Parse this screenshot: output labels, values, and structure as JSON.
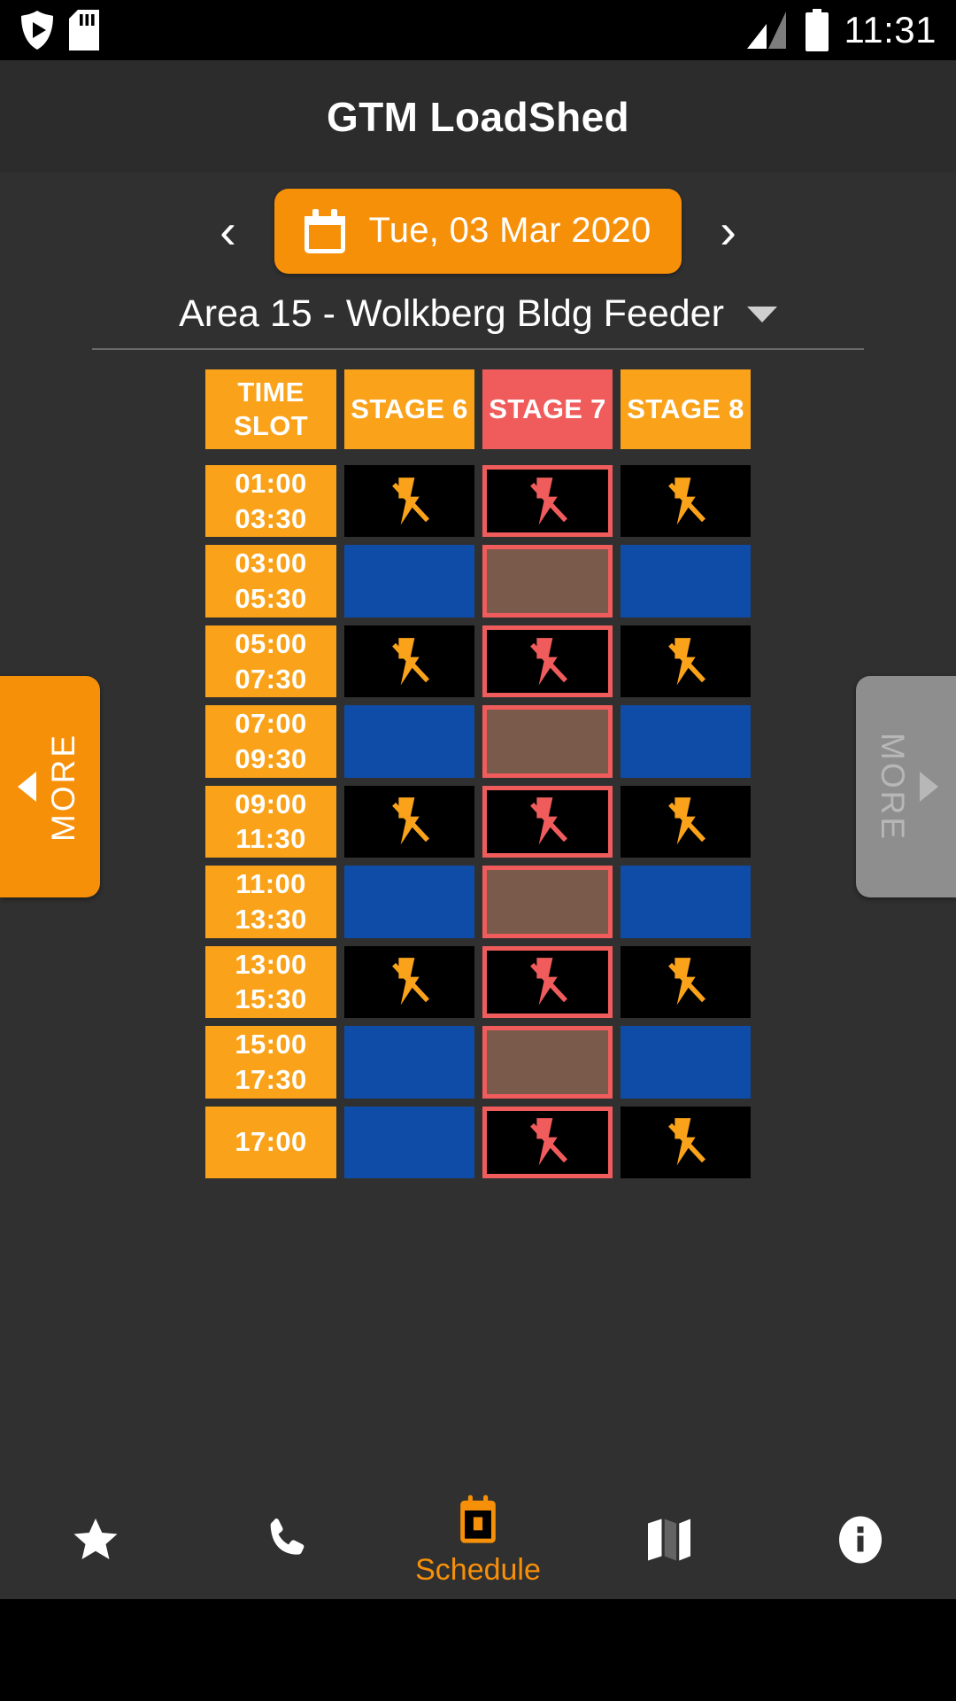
{
  "statusbar": {
    "time": "11:31",
    "icons": [
      "shield-play-icon",
      "sd-card-icon",
      "signal-icon",
      "battery-icon"
    ]
  },
  "appbar": {
    "title": "GTM LoadShed"
  },
  "date_nav": {
    "prev_label": "‹",
    "next_label": "›",
    "date": "Tue, 03 Mar 2020",
    "calendar_icon": "calendar-icon",
    "pill_color": "#f79009"
  },
  "area_select": {
    "value": "Area 15 - Wolkberg Bldg Feeder",
    "caret_icon": "chevron-down-icon"
  },
  "more_buttons": {
    "left": {
      "label": "MORE",
      "arrow": "triangle-left-icon",
      "enabled": true,
      "color": "#f79009"
    },
    "right": {
      "label": "MORE",
      "arrow": "triangle-right-icon",
      "enabled": false,
      "color": "#8e8e8e"
    }
  },
  "schedule_table": {
    "headers": [
      {
        "label": "TIME\nSLOT",
        "line1": "TIME",
        "line2": "SLOT",
        "active": false
      },
      {
        "label": "STAGE 6",
        "line1": "STAGE 6",
        "line2": "",
        "active": false
      },
      {
        "label": "STAGE 7",
        "line1": "STAGE 7",
        "line2": "",
        "active": true
      },
      {
        "label": "STAGE 8",
        "line1": "STAGE 8",
        "line2": "",
        "active": false
      }
    ],
    "rows": [
      {
        "start": "01:00",
        "end": "03:30",
        "cells": [
          "off",
          "off",
          "off"
        ]
      },
      {
        "start": "03:00",
        "end": "05:30",
        "cells": [
          "on",
          "on",
          "on"
        ]
      },
      {
        "start": "05:00",
        "end": "07:30",
        "cells": [
          "off",
          "off",
          "off"
        ]
      },
      {
        "start": "07:00",
        "end": "09:30",
        "cells": [
          "on",
          "on",
          "on"
        ]
      },
      {
        "start": "09:00",
        "end": "11:30",
        "cells": [
          "off",
          "off",
          "off"
        ]
      },
      {
        "start": "11:00",
        "end": "13:30",
        "cells": [
          "on",
          "on",
          "on"
        ]
      },
      {
        "start": "13:00",
        "end": "15:30",
        "cells": [
          "off",
          "off",
          "off"
        ]
      },
      {
        "start": "15:00",
        "end": "17:30",
        "cells": [
          "on",
          "on",
          "on"
        ]
      },
      {
        "start": "17:00",
        "end": "",
        "cells": [
          "on",
          "off",
          "off"
        ]
      }
    ],
    "colors": {
      "header": "#f9a21a",
      "header_active": "#f05c5c",
      "time": "#f9a21a",
      "off": "#000000",
      "on": "#0e4ca8",
      "on_selected": "#7a5a4a",
      "selection_border": "#f05c5c",
      "bolt_normal": "#f9a21a",
      "bolt_selected": "#f05c5c"
    },
    "selected_column_index": 2
  },
  "bottom_nav": {
    "items": [
      {
        "icon": "star-icon",
        "label": "",
        "active": false
      },
      {
        "icon": "phone-icon",
        "label": "",
        "active": false
      },
      {
        "icon": "calendar-icon",
        "label": "Schedule",
        "active": true
      },
      {
        "icon": "map-icon",
        "label": "",
        "active": false
      },
      {
        "icon": "info-icon",
        "label": "",
        "active": false
      }
    ],
    "active_color": "#f79009"
  }
}
